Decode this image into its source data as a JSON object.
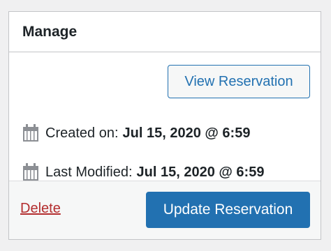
{
  "panel": {
    "title": "Manage"
  },
  "actions": {
    "view_label": "View Reservation"
  },
  "meta": {
    "created": {
      "label": "Created on:",
      "value": "Jul 15, 2020 @ 6:59",
      "icon": "calendar-icon"
    },
    "modified": {
      "label": "Last Modified:",
      "value": "Jul 15, 2020 @ 6:59",
      "icon": "calendar-icon"
    }
  },
  "footer": {
    "delete_label": "Delete",
    "update_label": "Update Reservation"
  },
  "colors": {
    "accent": "#2271b1",
    "danger": "#b32d2e",
    "text": "#1d2327",
    "icon": "#8c8f94",
    "border": "#c3c4c7"
  }
}
